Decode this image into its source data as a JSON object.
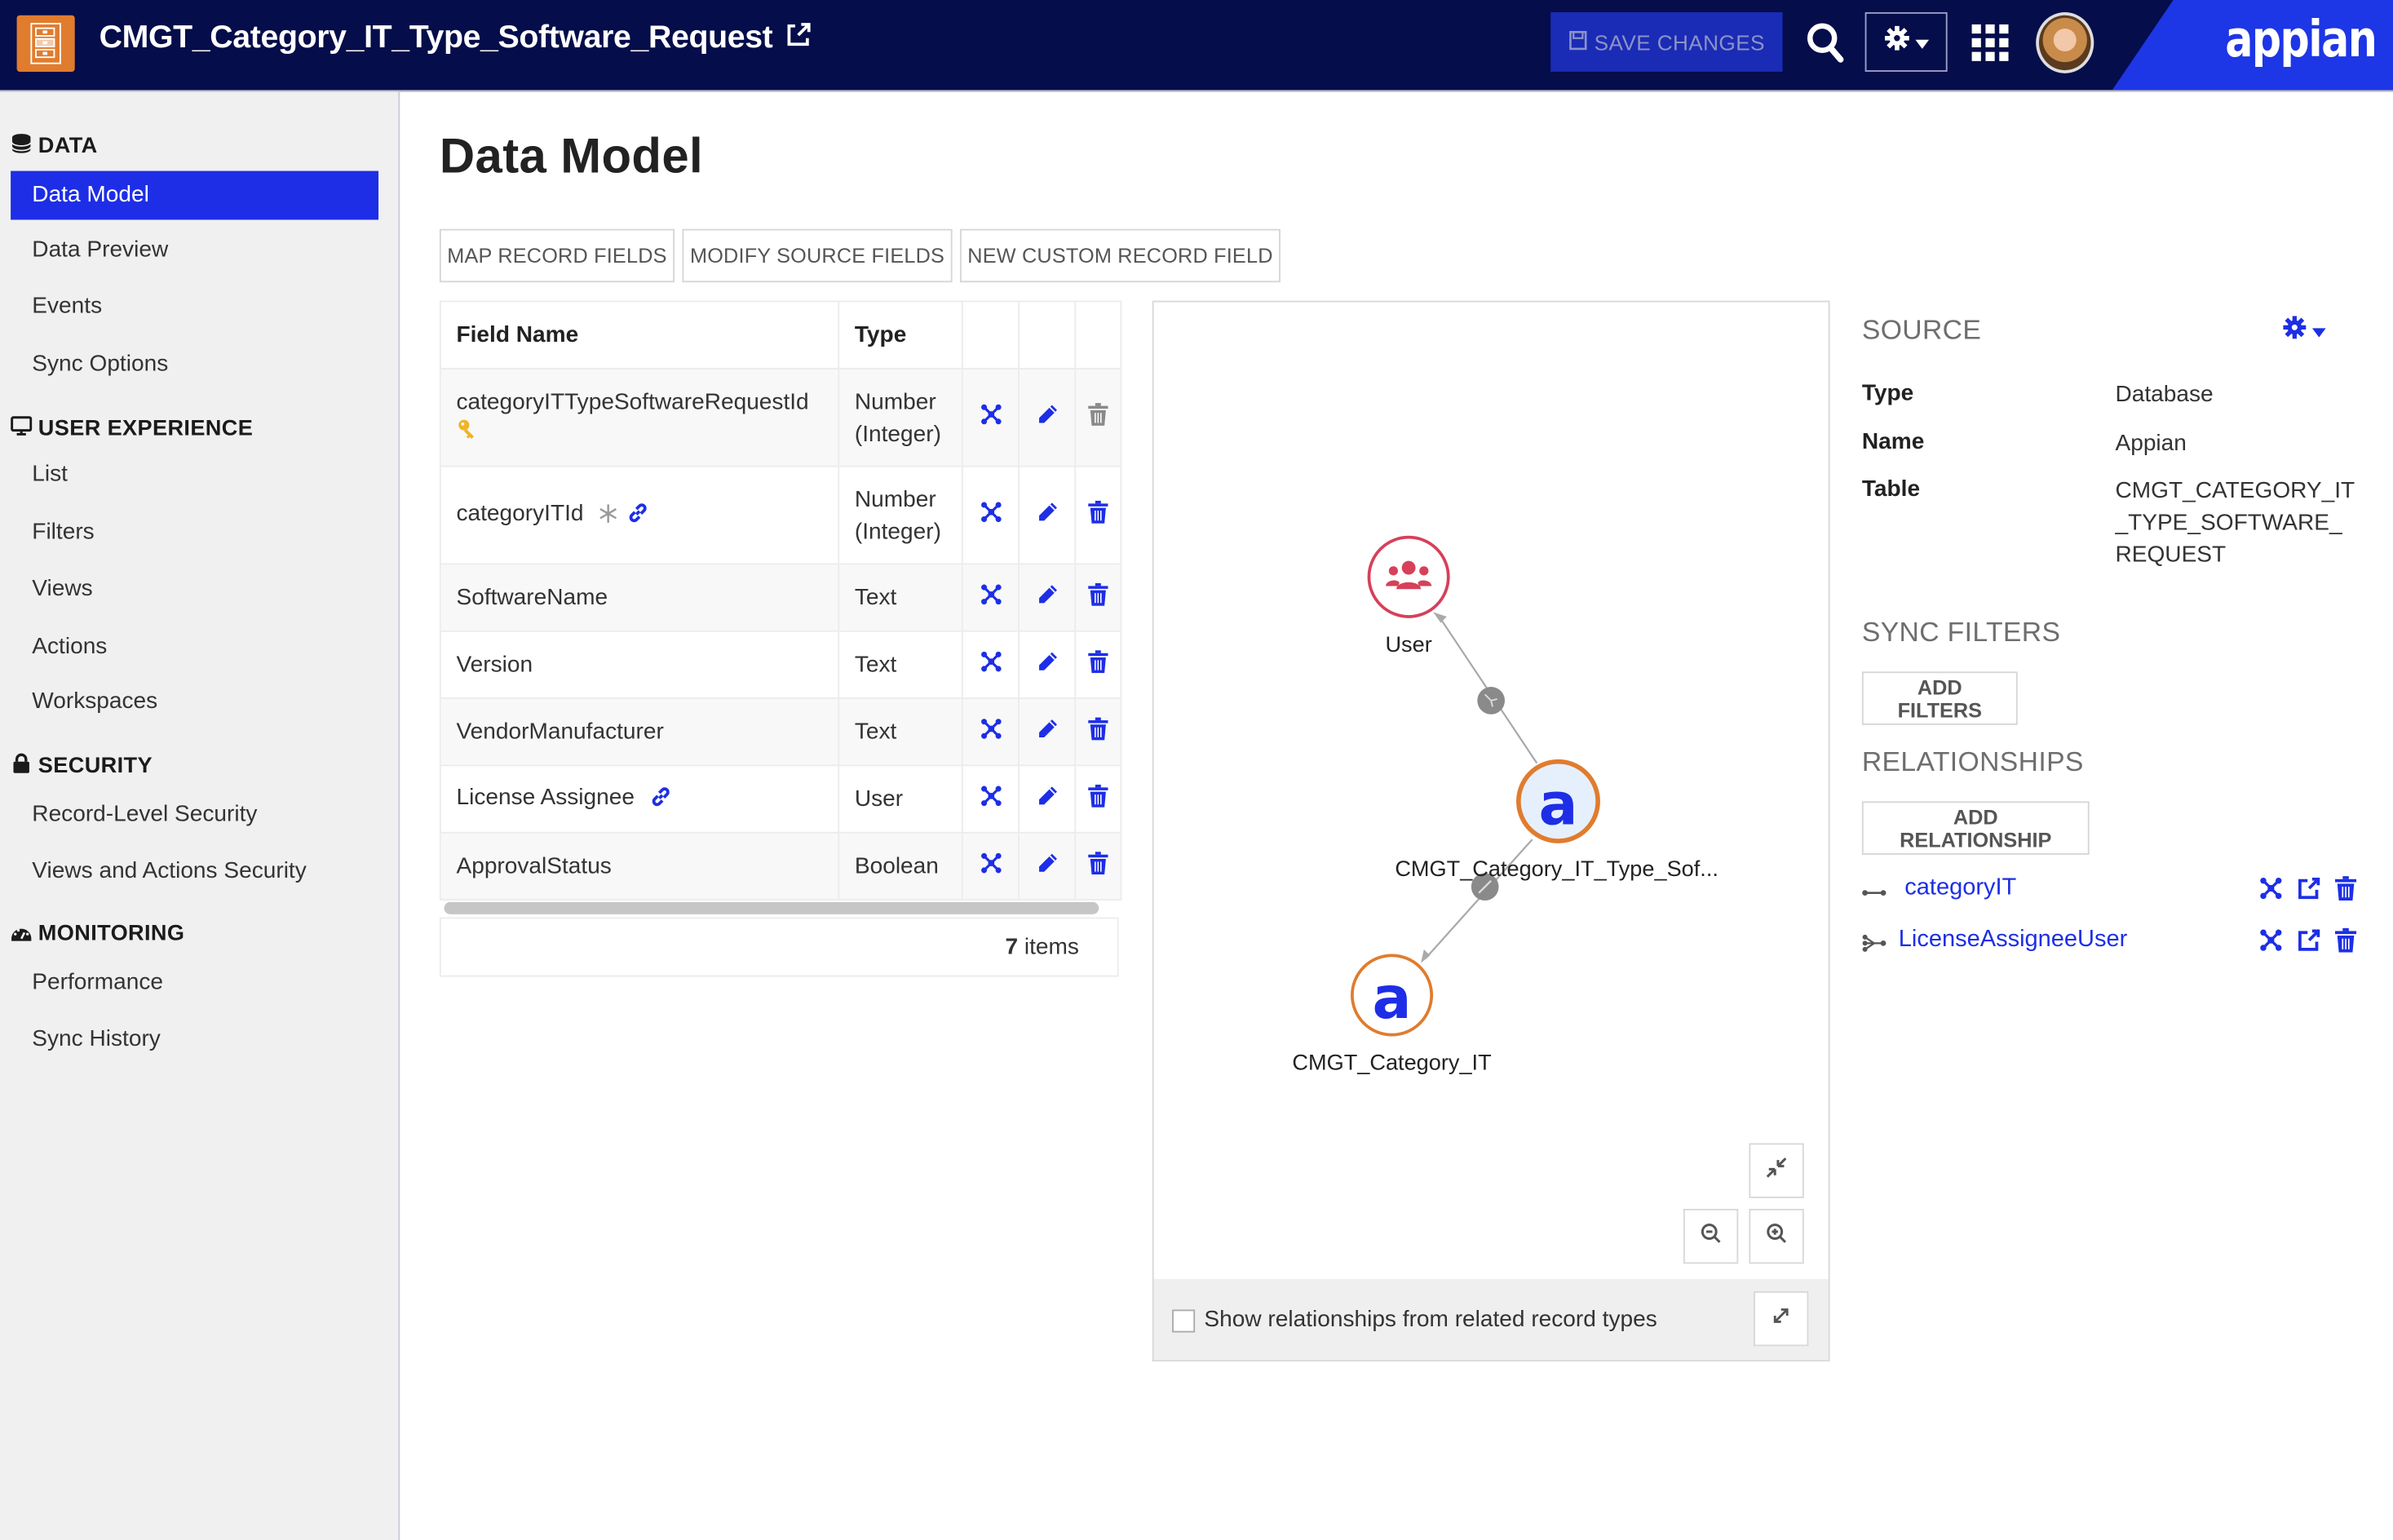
{
  "header": {
    "record_type_title": "CMGT_Category_IT_Type_Software_Request",
    "save_label": "SAVE CHANGES",
    "brand": "appian",
    "icons": [
      "record-type-icon",
      "external-link-icon",
      "save-icon",
      "search-icon",
      "gear-icon",
      "app-grid-icon",
      "user-avatar"
    ]
  },
  "sidebar": {
    "sections": [
      {
        "title": "DATA",
        "icon": "database-icon",
        "items": [
          {
            "label": "Data Model",
            "active": true
          },
          {
            "label": "Data Preview"
          },
          {
            "label": "Events"
          },
          {
            "label": "Sync Options"
          }
        ]
      },
      {
        "title": "USER EXPERIENCE",
        "icon": "monitor-icon",
        "items": [
          {
            "label": "List"
          },
          {
            "label": "Filters"
          },
          {
            "label": "Views"
          },
          {
            "label": "Actions"
          },
          {
            "label": "Workspaces"
          }
        ]
      },
      {
        "title": "SECURITY",
        "icon": "lock-icon",
        "items": [
          {
            "label": "Record-Level Security"
          },
          {
            "label": "Views and Actions Security"
          }
        ]
      },
      {
        "title": "MONITORING",
        "icon": "dashboard-icon",
        "items": [
          {
            "label": "Performance"
          },
          {
            "label": "Sync History"
          }
        ]
      }
    ]
  },
  "main": {
    "title": "Data Model",
    "toolbar": [
      "MAP RECORD FIELDS",
      "MODIFY SOURCE FIELDS",
      "NEW CUSTOM RECORD FIELD"
    ],
    "table": {
      "columns": [
        "Field Name",
        "Type",
        "",
        "",
        ""
      ],
      "rows": [
        {
          "name": "categoryITTypeSoftwareRequestId",
          "type_line1": "Number",
          "type_line2": "(Integer)",
          "badges": [
            "primary-key-icon"
          ],
          "delete_enabled": false
        },
        {
          "name": "categoryITId",
          "type_line1": "Number",
          "type_line2": "(Integer)",
          "badges": [
            "synced-snowflake-icon",
            "relationship-link-icon"
          ],
          "delete_enabled": true
        },
        {
          "name": "SoftwareName",
          "type_line1": "Text",
          "type_line2": "",
          "badges": [],
          "delete_enabled": true
        },
        {
          "name": "Version",
          "type_line1": "Text",
          "type_line2": "",
          "badges": [],
          "delete_enabled": true
        },
        {
          "name": "VendorManufacturer",
          "type_line1": "Text",
          "type_line2": "",
          "badges": [],
          "delete_enabled": true
        },
        {
          "name": "License Assignee",
          "type_line1": "User",
          "type_line2": "",
          "badges": [
            "relationship-link-icon"
          ],
          "delete_enabled": true
        },
        {
          "name": "ApprovalStatus",
          "type_line1": "Boolean",
          "type_line2": "",
          "badges": [],
          "delete_enabled": true
        }
      ],
      "count": "7",
      "count_suffix": " items"
    },
    "diagram": {
      "nodes": [
        {
          "id": "user",
          "label": "User",
          "kind": "user"
        },
        {
          "id": "self",
          "label": "CMGT_Category_IT_Type_Sof...",
          "kind": "record"
        },
        {
          "id": "cat",
          "label": "CMGT_Category_IT",
          "kind": "record"
        }
      ],
      "edges": [
        {
          "from": "self",
          "to": "user",
          "relationship": "many-to-one"
        },
        {
          "from": "self",
          "to": "cat",
          "relationship": "one-to-one"
        }
      ],
      "show_related_label": "Show relationships from related record types",
      "show_related_checked": false
    }
  },
  "source_panel": {
    "source_heading": "SOURCE",
    "type_label": "Type",
    "type_value": "Database",
    "name_label": "Name",
    "name_value": "Appian",
    "table_label": "Table",
    "table_value": "CMGT_CATEGORY_IT_TYPE_SOFTWARE_REQUEST",
    "sync_filters_heading": "SYNC FILTERS",
    "add_filters_label": "ADD FILTERS",
    "relationships_heading": "RELATIONSHIPS",
    "add_relationship_label": "ADD RELATIONSHIP",
    "relationships": [
      {
        "name": "categoryIT",
        "icon": "one-to-one-icon"
      },
      {
        "name": "LicenseAssigneeUser",
        "icon": "many-to-one-icon"
      }
    ]
  },
  "colors": {
    "header_bg": "#050d4a",
    "accent": "#1d2ee6",
    "record_icon": "#e07c2e",
    "user_node": "#d6405a",
    "sidebar_bg": "#f0f0f0"
  }
}
